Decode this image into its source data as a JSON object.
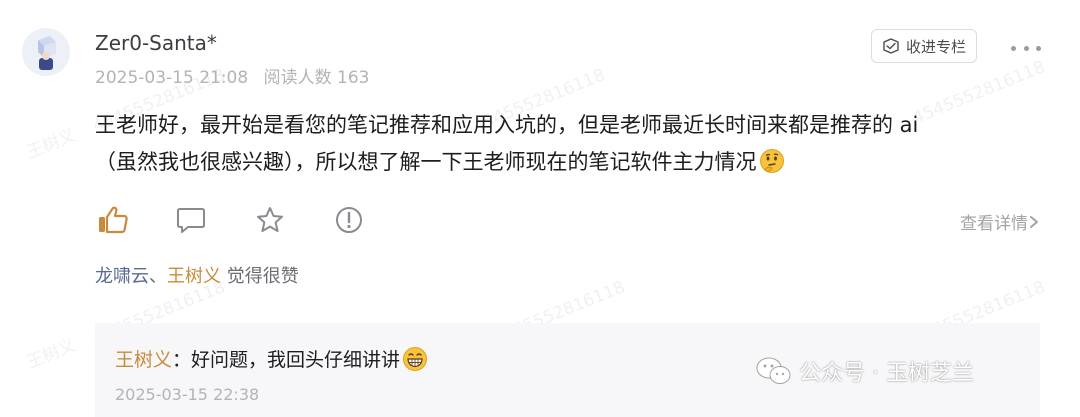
{
  "comment": {
    "username": "Zer0-Santa*",
    "date": "2025-03-15 21:08",
    "readers": "阅读人数 163",
    "line1": "王老师好，最开始是看您的笔记推荐和应用入坑的，但是老师最近长时间来都是推荐的 ai",
    "line2": "（虽然我也很感兴趣），所以想了解一下王老师现在的笔记软件主力情况"
  },
  "header_actions": {
    "collect_label": "收进专栏"
  },
  "actions": {
    "view_detail_label": "查看详情",
    "icons": [
      "like-icon",
      "comment-icon",
      "star-icon",
      "report-icon",
      "more-icon"
    ]
  },
  "likes": {
    "name1": "龙啸云",
    "separator": "、",
    "name2": "王树义",
    "suffix": " 觉得很赞"
  },
  "reply": {
    "author": "王树义",
    "colon": "：",
    "text": "好问题，我回头仔细讲讲",
    "date": "2025-03-15 22:38"
  },
  "watermarks": {
    "name_text": "王树义",
    "id_text": "4545552816118",
    "official": "公众号 · 玉树芝兰"
  },
  "colors": {
    "accent_gold": "#c98b3b",
    "like_blue": "#576b95",
    "muted": "#b3b3b8"
  }
}
